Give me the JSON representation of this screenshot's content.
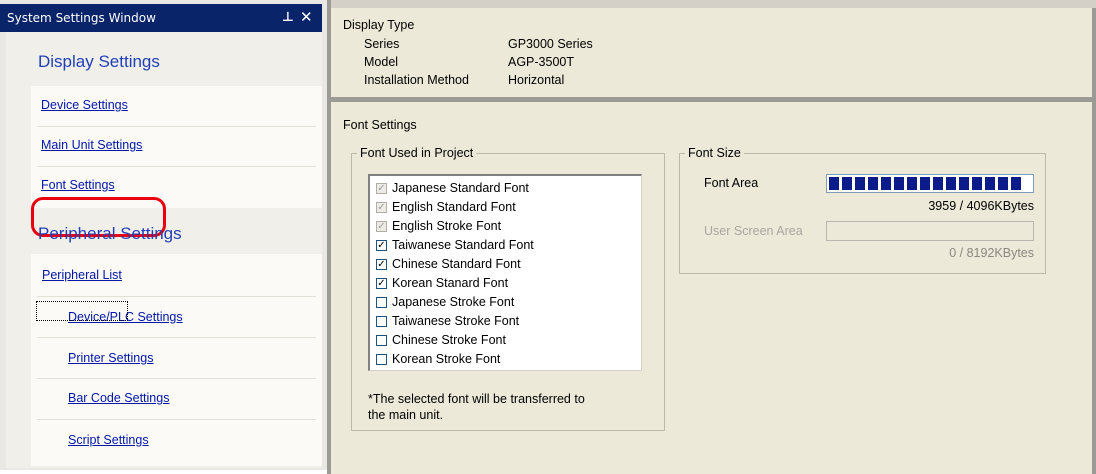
{
  "window": {
    "title": "System Settings Window",
    "pin_glyph": "ᴨ",
    "close_glyph": "✕"
  },
  "nav": {
    "display_heading": "Display Settings",
    "display_items": [
      "Device Settings",
      "Main Unit Settings",
      "Font Settings"
    ],
    "peripheral_heading": "Peripheral Settings",
    "peripheral_list": "Peripheral List",
    "peripheral_items": [
      "Device/PLC Settings",
      "Printer Settings",
      "Bar Code Settings",
      "Script Settings"
    ],
    "selected": "Font Settings",
    "highlight_color": "#e8000f"
  },
  "display_type": {
    "heading": "Display Type",
    "series_label": "Series",
    "series_value": "GP3000 Series",
    "model_label": "Model",
    "model_value": "AGP-3500T",
    "installation_label": "Installation Method",
    "installation_value": "Horizontal"
  },
  "font_settings": {
    "heading": "Font Settings",
    "used_group_label": "Font Used in Project",
    "fonts": [
      {
        "name": "Japanese Standard Font",
        "checked": true,
        "disabled": true
      },
      {
        "name": "English Standard Font",
        "checked": true,
        "disabled": true
      },
      {
        "name": "English Stroke Font",
        "checked": true,
        "disabled": true
      },
      {
        "name": "Taiwanese Standard Font",
        "checked": true,
        "disabled": false
      },
      {
        "name": "Chinese Standard Font",
        "checked": true,
        "disabled": false
      },
      {
        "name": "Korean Stanard Font",
        "checked": true,
        "disabled": false
      },
      {
        "name": "Japanese Stroke Font",
        "checked": false,
        "disabled": false
      },
      {
        "name": "Taiwanese Stroke Font",
        "checked": false,
        "disabled": false
      },
      {
        "name": "Chinese Stroke Font",
        "checked": false,
        "disabled": false
      },
      {
        "name": "Korean Stroke Font",
        "checked": false,
        "disabled": false
      }
    ],
    "note_line1": "*The selected font will be transferred to",
    "note_line2": "the main unit.",
    "size_group_label": "Font Size",
    "font_area_label": "Font Area",
    "font_area_fill_fraction": 0.9666,
    "font_area_value": "3959 / 4096KBytes",
    "user_screen_label": "User Screen Area",
    "user_screen_fill_fraction": 0,
    "user_screen_value": "0 / 8192KBytes",
    "bar_color": "#0b1c8a"
  }
}
